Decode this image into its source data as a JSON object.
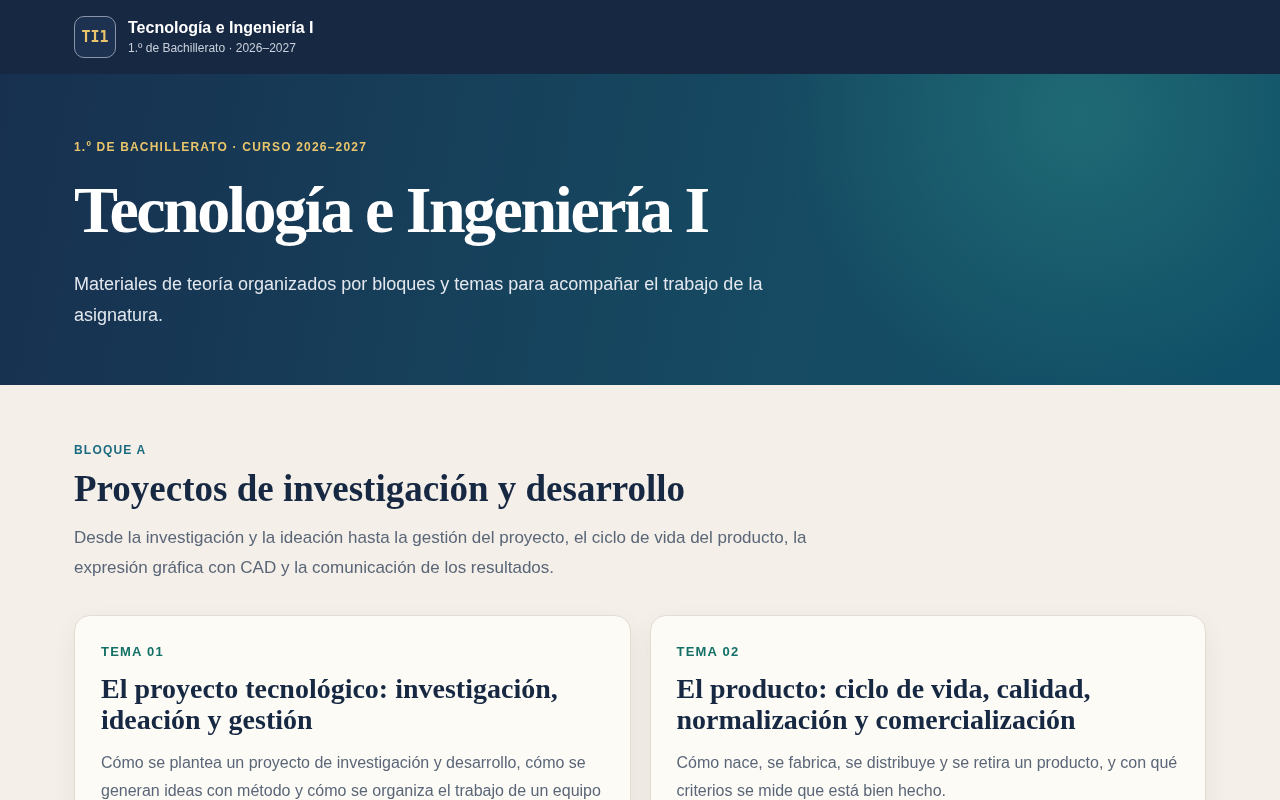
{
  "header": {
    "logo": "TI1",
    "title": "Tecnología e Ingeniería I",
    "subtitle": "1.º de Bachillerato · 2026–2027"
  },
  "hero": {
    "eyebrow": "1.º DE BACHILLERATO · CURSO 2026–2027",
    "title": "Tecnología e Ingeniería I",
    "lead": "Materiales de teoría organizados por bloques y temas para acompañar el trabajo de la asignatura."
  },
  "block": {
    "eyebrow": "BLOQUE A",
    "title": "Proyectos de investigación y desarrollo",
    "description": "Desde la investigación y la ideación hasta la gestión del proyecto, el ciclo de vida del producto, la expresión gráfica con CAD y la comunicación de los resultados.",
    "topics": [
      {
        "label": "TEMA 01",
        "title": "El proyecto tecnológico: investigación, ideación y gestión",
        "description": "Cómo se plantea un proyecto de investigación y desarrollo, cómo se generan ideas con método y cómo se organiza el trabajo de un equipo"
      },
      {
        "label": "TEMA 02",
        "title": "El producto: ciclo de vida, calidad, normalización y comercialización",
        "description": "Cómo nace, se fabrica, se distribuye y se retira un producto, y con qué criterios se mide que está bien hecho."
      }
    ]
  }
}
